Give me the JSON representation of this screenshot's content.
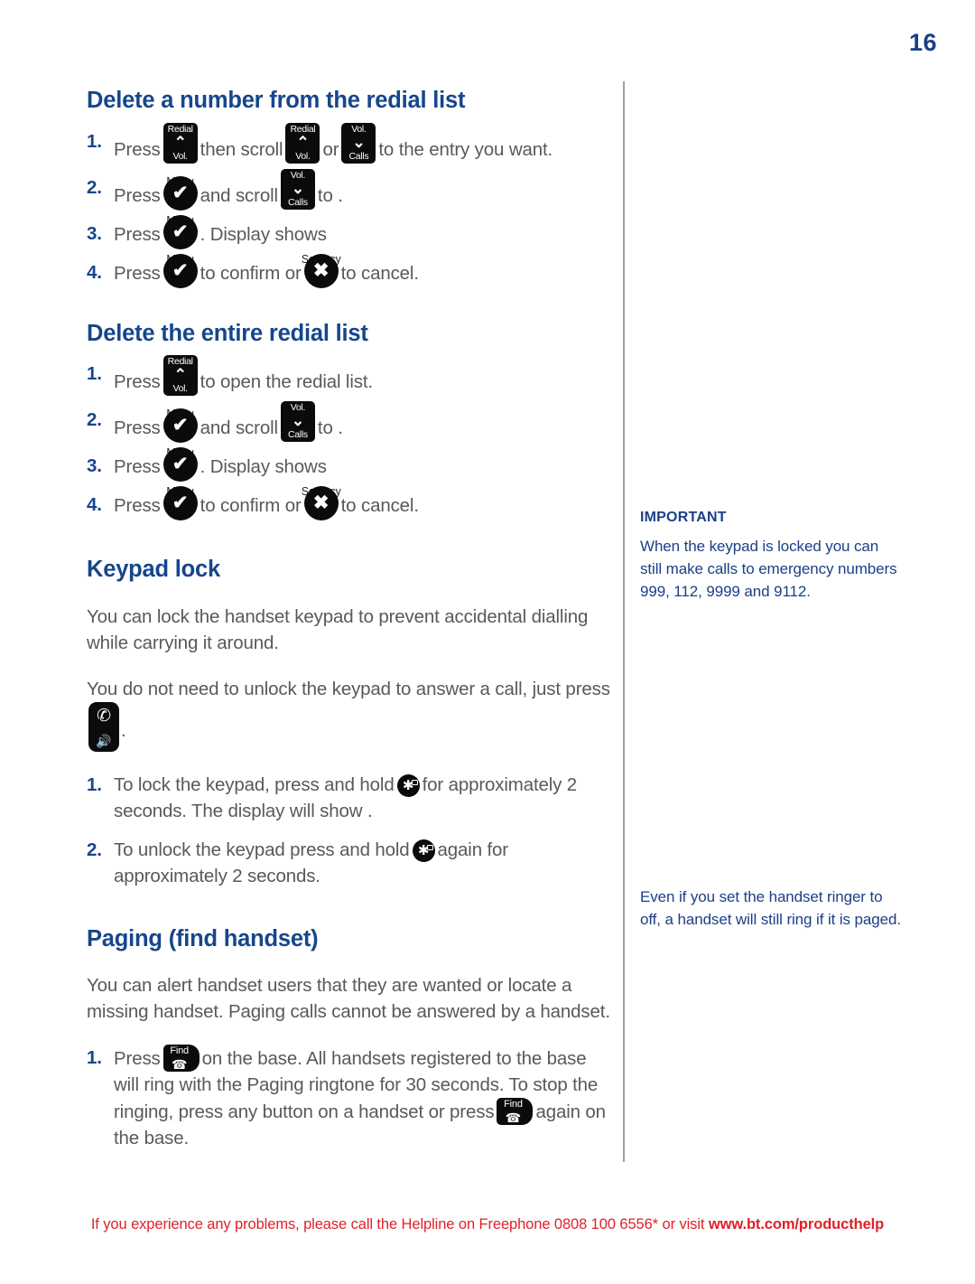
{
  "page": {
    "number": "16",
    "accent_blue": "#16468c",
    "note_blue": "#1b3f87",
    "body_gray": "#58595b",
    "footer_red": "#e0202a"
  },
  "sections": [
    {
      "id": "delete-number-redial",
      "title": "Delete a number from the redial list",
      "steps": [
        {
          "num": "1.",
          "parts": [
            "Press",
            "then scroll",
            "or",
            "to the entry you want."
          ]
        },
        {
          "num": "2.",
          "parts": [
            "Press",
            "and scroll",
            "to ."
          ]
        },
        {
          "num": "3.",
          "parts": [
            "Press",
            ". Display shows"
          ]
        },
        {
          "num": "4.",
          "parts": [
            "Press",
            "to confirm or",
            "to cancel."
          ]
        }
      ]
    },
    {
      "id": "delete-entire-redial",
      "title": "Delete the entire redial list",
      "steps": [
        {
          "num": "1.",
          "parts": [
            "Press",
            "to open the redial list."
          ]
        },
        {
          "num": "2.",
          "parts": [
            "Press",
            "and scroll",
            "to ."
          ]
        },
        {
          "num": "3.",
          "parts": [
            "Press",
            ". Display shows"
          ]
        },
        {
          "num": "4.",
          "parts": [
            "Press",
            "to confirm or",
            "to cancel."
          ]
        }
      ]
    },
    {
      "id": "keypad-lock",
      "title": "Keypad lock",
      "paragraphs": [
        "You can lock the handset keypad to prevent accidental dialling while carrying it around.",
        "You do not need to unlock the keypad to answer a call, just press"
      ],
      "steps": [
        {
          "num": "1.",
          "parts": [
            "To lock the keypad, press and hold",
            "for approximately 2 seconds. The display will show ."
          ]
        },
        {
          "num": "2.",
          "parts": [
            "To unlock the keypad press and hold",
            "again for approximately 2 seconds."
          ]
        }
      ]
    },
    {
      "id": "paging",
      "title": "Paging (find handset)",
      "paragraphs": [
        "You can alert handset users that they are wanted or locate a missing handset. Paging calls cannot be answered by a handset."
      ],
      "steps": [
        {
          "num": "1.",
          "parts": [
            "Press",
            "on the base. All handsets registered to the base will ring with the Paging ringtone for 30 seconds. To stop the ringing, press any button on a handset or press",
            "again on the base."
          ]
        }
      ]
    }
  ],
  "keys": {
    "redial_vol_up": {
      "top": "Redial",
      "chevron": "⌃",
      "bottom": "Vol."
    },
    "vol_down_calls": {
      "top": "Vol.",
      "chevron": "⌄",
      "bottom": "Calls"
    },
    "menu_ok": {
      "label_above": "Menu",
      "glyph": "✔"
    },
    "secrecy_cancel": {
      "label_above": "Secrecy",
      "glyph": "✖"
    },
    "answer_handsfree": {
      "phone_glyph": "✆",
      "speaker_glyph": "🔊"
    },
    "star_lock": {
      "glyph": "✱"
    },
    "find": {
      "label": "Find",
      "glyph": "☎"
    }
  },
  "sidebar": {
    "important": {
      "heading": "IMPORTANT",
      "text": "When the keypad is locked you can still make calls to emergency numbers 999, 112, 9999 and 9112."
    },
    "ringer_note": {
      "text": "Even if you set the handset ringer to off, a handset will still ring if it is paged."
    }
  },
  "footer": {
    "text": "If you experience any problems, please call the Helpline on Freephone 0808 100 6556* or visit ",
    "link": "www.bt.com/producthelp"
  }
}
